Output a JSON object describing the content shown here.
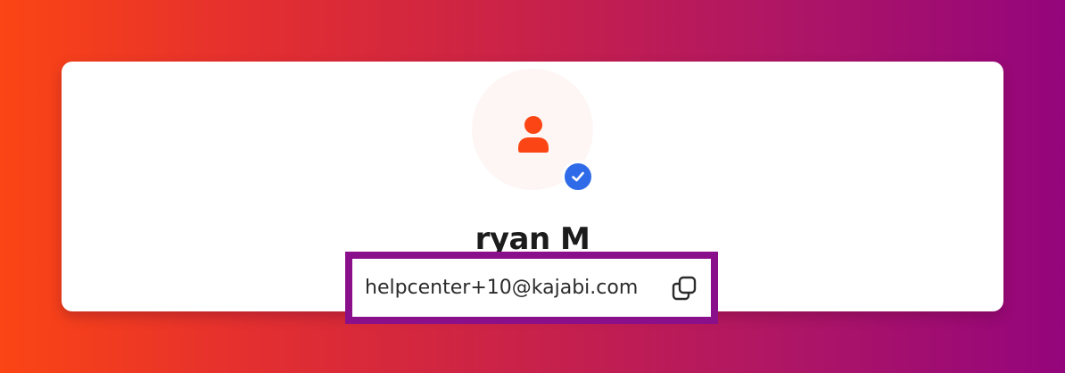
{
  "profile": {
    "name": "ryan M",
    "email": "helpcenter+10@kajabi.com",
    "avatar_icon": "person-icon",
    "verified_icon": "check-icon",
    "copy_icon": "copy-icon"
  },
  "colors": {
    "avatar_bg": "#fdf6f4",
    "avatar_icon": "#fb4514",
    "verified_badge": "#2f6be8",
    "highlight_border": "#8a0f8a",
    "text": "#1c1c1c"
  }
}
